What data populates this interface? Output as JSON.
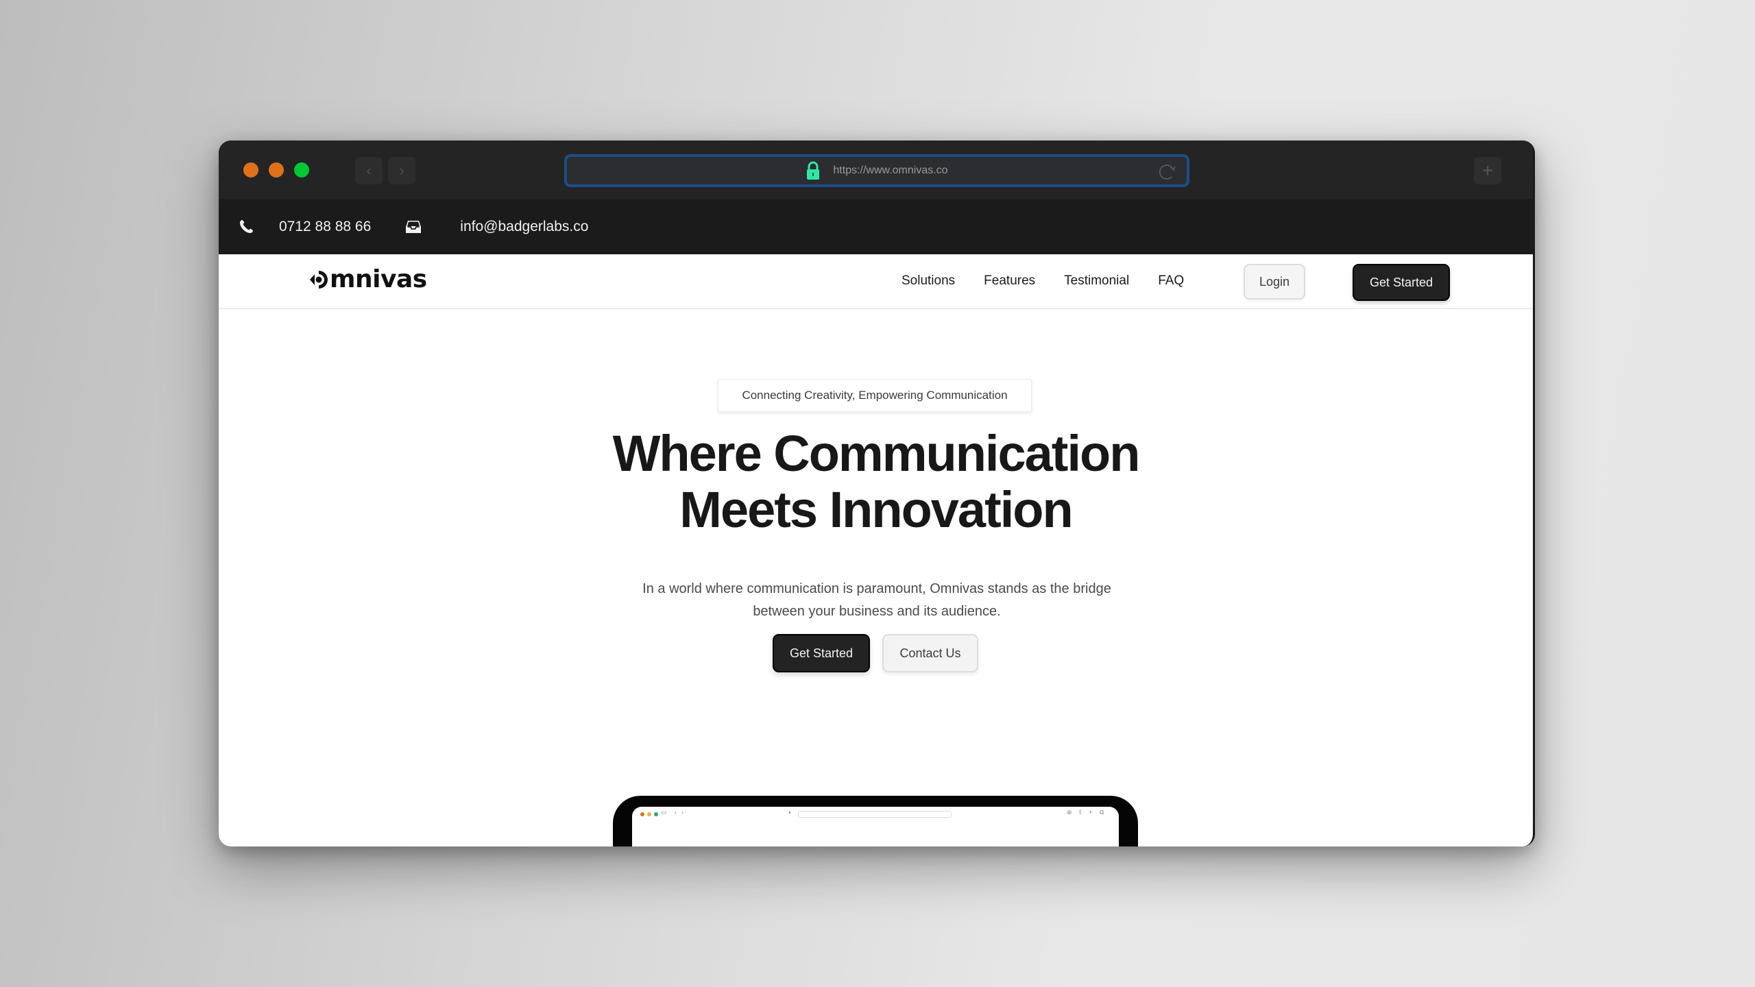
{
  "browser": {
    "traffic_lights": [
      "#e0711b",
      "#e0711b",
      "#00c832"
    ],
    "url": "https://www.omnivas.co",
    "back_icon": "chevron-left-icon",
    "forward_icon": "chevron-right-icon",
    "new_tab_icon": "plus-icon",
    "lock_color": "#2ee8a6",
    "url_border_color": "#1d4e86"
  },
  "topbar": {
    "phone": "0712 88 88 66",
    "email": "info@badgerlabs.co"
  },
  "nav": {
    "logo": "mnivas",
    "items": [
      "Solutions",
      "Features",
      "Testimonial",
      "FAQ"
    ],
    "login_label": "Login",
    "get_started_label": "Get Started"
  },
  "hero": {
    "tagline": "Connecting Creativity, Empowering Communication",
    "headline_line1": "Where Communication",
    "headline_line2": "Meets Innovation",
    "subtext_line1": "In a world where communication is paramount, Omnivas stands as the bridge",
    "subtext_line2": "between your business and its audience.",
    "primary_cta": "Get Started",
    "secondary_cta": "Contact Us"
  },
  "preview": {
    "traffic_lights": [
      "#e0711b",
      "#e8b04a",
      "#2aa87a"
    ]
  }
}
